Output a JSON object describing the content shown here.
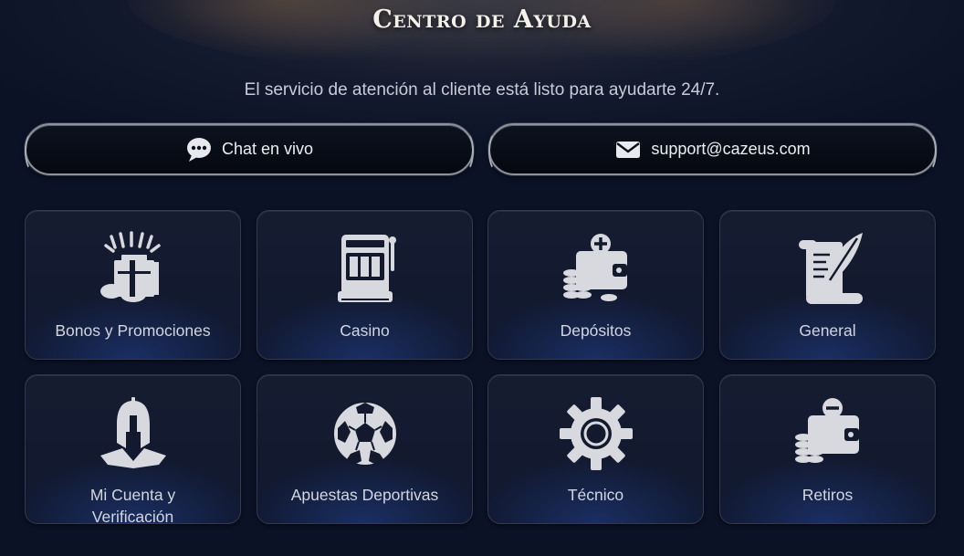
{
  "header": {
    "title": "Centro de Ayuda",
    "subtitle": "El servicio de atención al cliente está listo para ayudarte 24/7."
  },
  "contact": {
    "chat": {
      "label": "Chat en vivo",
      "icon": "chat-bubble-icon"
    },
    "email": {
      "label": "support@cazeus.com",
      "icon": "envelope-icon"
    }
  },
  "categories": [
    {
      "label": "Bonos y Promociones",
      "icon": "gift-box-icon"
    },
    {
      "label": "Casino",
      "icon": "slot-machine-icon"
    },
    {
      "label": "Depósitos",
      "icon": "wallet-plus-icon"
    },
    {
      "label": "General",
      "icon": "scroll-quill-icon"
    },
    {
      "label": "Mi Cuenta y Verificación",
      "icon": "spartan-helmet-icon"
    },
    {
      "label": "Apuestas Deportivas",
      "icon": "soccer-ball-icon"
    },
    {
      "label": "Técnico",
      "icon": "gear-icon"
    },
    {
      "label": "Retiros",
      "icon": "wallet-minus-icon"
    }
  ],
  "colors": {
    "background": "#0b1226",
    "icon": "#d8d9de",
    "text": "#d3d6de"
  }
}
